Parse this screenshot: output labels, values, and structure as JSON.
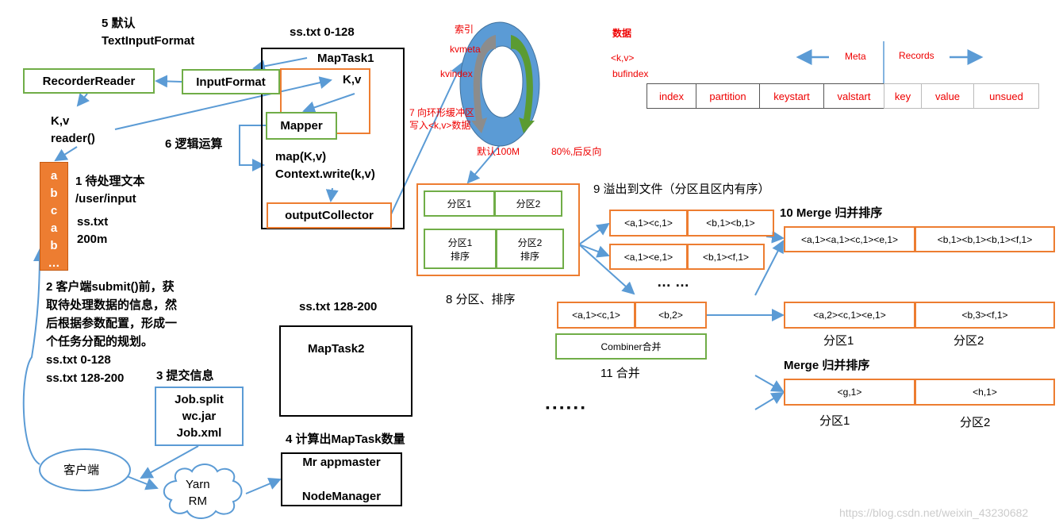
{
  "left": {
    "step5": "5 默认",
    "textinputformat": "TextInputFormat",
    "split1": "ss.txt 0-128",
    "maptask1": "MapTask1",
    "recorder_reader": "RecorderReader",
    "input_format": "InputFormat",
    "kv_inner": "K,v",
    "mapper": "Mapper",
    "map_call": "map(K,v)",
    "context_write": "Context.write(k,v)",
    "output_collector": "outputCollector",
    "kv": "K,v",
    "reader": "reader()",
    "step6": "6 逻辑运算",
    "file_letters": [
      "a",
      "b",
      "c",
      "a",
      "b",
      "…"
    ],
    "step1": "1 待处理文本",
    "path": "/user/input",
    "file": "ss.txt",
    "size": "200m",
    "step2_lines": [
      "2 客户端submit()前，获",
      "取待处理数据的信息，然",
      "后根据参数配置，形成一",
      "个任务分配的规划。"
    ],
    "split_a": "ss.txt  0-128",
    "split_b": "ss.txt  128-200",
    "step3": "3 提交信息",
    "job_files": [
      "Job.split",
      "wc.jar",
      "Job.xml"
    ],
    "client": "客户端",
    "yarn": "Yarn",
    "rm": "RM",
    "split2": "ss.txt 128-200",
    "maptask2": "MapTask2",
    "step4": "4 计算出MapTask数量",
    "mr_appmaster": "Mr appmaster",
    "node_manager": "NodeManager"
  },
  "ring": {
    "index_label": "索引",
    "kvmeta": "kvmeta",
    "kvindex": "kvindex",
    "data_label": "数据",
    "kv": "<k,v>",
    "bufindex": "bufindex",
    "step7_a": "7 向环形缓冲区",
    "step7_b": "写入<k,v>数据",
    "default": "默认100M",
    "reverse": "80%,后反向"
  },
  "meta": {
    "meta": "Meta",
    "records": "Records",
    "cells": [
      "index",
      "partition",
      "keystart",
      "valstart",
      "key",
      "value",
      "unsued"
    ]
  },
  "sort": {
    "p1": "分区1",
    "p2": "分区2",
    "p1s": "分区1\n排序",
    "p2s": "分区2\n排序",
    "step8": "8 分区、排序",
    "step9": "9 溢出到文件（分区且区内有序）",
    "spill1": [
      "<a,1><c,1>",
      "<b,1><b,1>"
    ],
    "spill2": [
      "<a,1><e,1>",
      "<b,1><f,1>"
    ],
    "dots": "…  …",
    "step10": "10 Merge 归并排序",
    "merged": [
      "<a,1><a,1><c,1><e,1>",
      "<b,1><b,1><b,1><f,1>"
    ],
    "combine_row": [
      "<a,1><c,1>",
      "<b,2>"
    ],
    "combiner": "Combiner合并",
    "step11": "11 合并",
    "combined": [
      "<a,2><c,1><e,1>",
      "<b,3><f,1>"
    ],
    "p1_label": "分区1",
    "p2_label": "分区2",
    "merge2": "Merge 归并排序",
    "final": [
      "<g,1>",
      "<h,1>"
    ],
    "dots2": "▪ ▪ ▪   ▪ ▪ ▪"
  },
  "watermark": "https://blog.csdn.net/weixin_43230682",
  "colors": {
    "green": "#70ad47",
    "orange": "#ed7d31",
    "blue": "#5b9bd5",
    "red": "#ff0000"
  }
}
